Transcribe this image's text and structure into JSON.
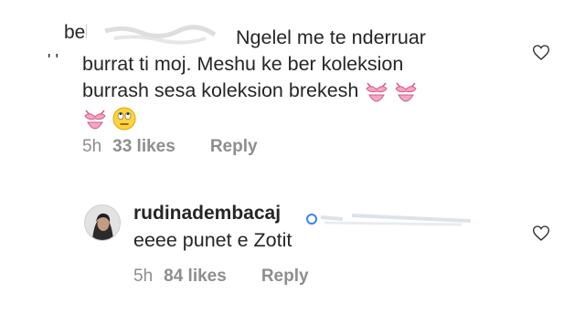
{
  "comments": [
    {
      "username_partial": "bebak",
      "text_line1": "Ngelel me te nderruar",
      "text_line2": "burrat ti moj. Meshu ke ber koleksion",
      "text_line3": "burrash sesa  koleksion brekesh",
      "emojis": [
        "bikini-emoji",
        "bikini-emoji",
        "bikini-emoji",
        "eye-roll-emoji"
      ],
      "time": "5h",
      "likes": "33 likes",
      "reply": "Reply"
    },
    {
      "username": "rudinadembacaj",
      "text": "eeee punet e Zotit",
      "time": "5h",
      "likes": "84 likes",
      "reply": "Reply"
    }
  ],
  "icons": {
    "like": "heart-outline-icon",
    "avatar": "profile-photo"
  },
  "colors": {
    "text": "#262626",
    "meta": "#8e8e8e",
    "bikini": "#e8799f"
  }
}
